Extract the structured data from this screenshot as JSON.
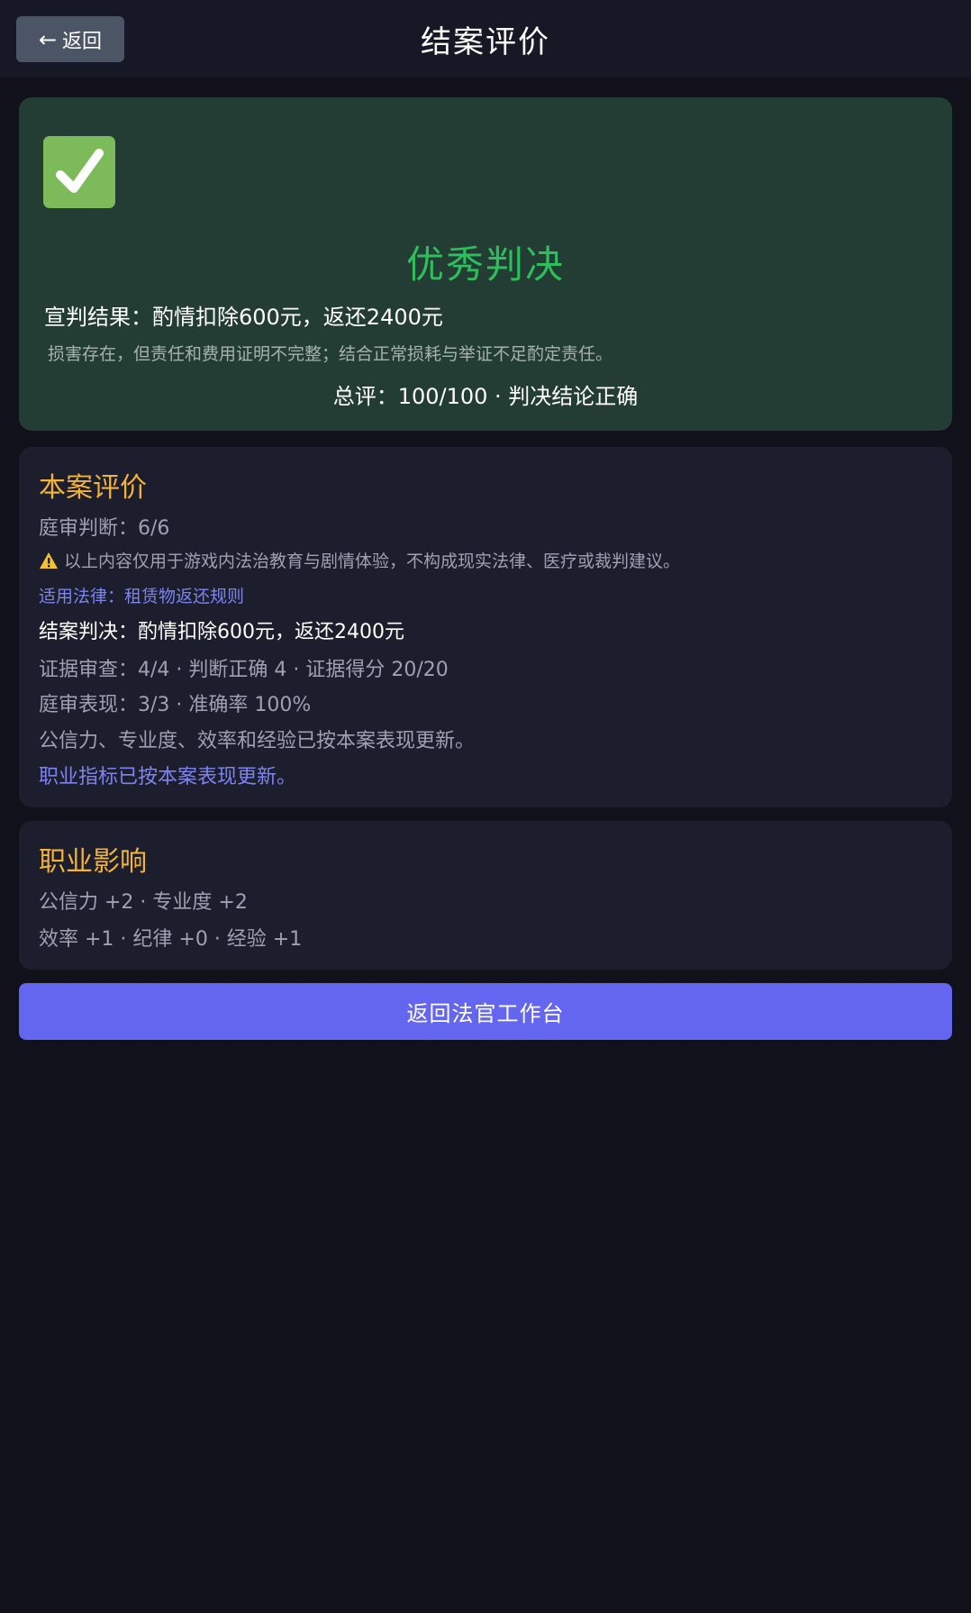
{
  "header": {
    "back_label": "返回",
    "title": "结案评价"
  },
  "verdict": {
    "title": "优秀判决",
    "result": "宣判结果：酌情扣除600元，返还2400元",
    "reason": "损害存在，但责任和费用证明不完整；结合正常损耗与举证不足酌定责任。",
    "score": "总评：100/100 · 判决结论正确",
    "accent_color": "#2ebf5c",
    "icon": "check-icon"
  },
  "evaluation": {
    "title": "本案评价",
    "trial_judgement": "庭审判断：6/6",
    "disclaimer": "以上内容仅用于游戏内法治教育与剧情体验，不构成现实法律、医疗或裁判建议。",
    "applicable_law": "适用法律：租赁物返还规则",
    "final_judgement": "结案判决：酌情扣除600元，返还2400元",
    "evidence_review": "证据审查：4/4 · 判断正确 4 · 证据得分 20/20",
    "trial_performance": "庭审表现：3/3 · 准确率 100%",
    "stats_updated": "公信力、专业度、效率和经验已按本案表现更新。",
    "career_updated": "职业指标已按本案表现更新。"
  },
  "impact": {
    "title": "职业影响",
    "line1": "公信力 +2 · 专业度 +2",
    "line2": "效率 +1 · 纪律 +0 · 经验 +1"
  },
  "actions": {
    "return_label": "返回法官工作台",
    "button_color": "#6466ef"
  }
}
